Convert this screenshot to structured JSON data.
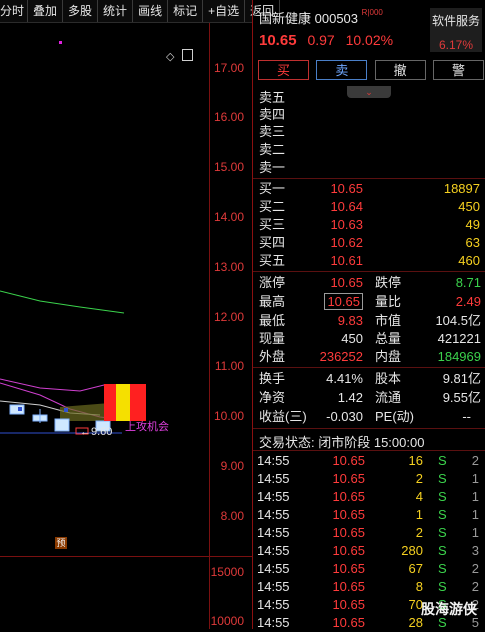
{
  "toolbar": {
    "items": [
      "分时",
      "叠加",
      "多股",
      "统计",
      "画线",
      "标记",
      "+自选",
      "返回"
    ]
  },
  "chart": {
    "y_labels": [
      "17.00",
      "16.00",
      "15.00",
      "14.00",
      "13.00",
      "12.00",
      "11.00",
      "10.00",
      "9.00",
      "8.00"
    ],
    "vol_labels": [
      "15000",
      "10000"
    ],
    "min_price_label": "←9.60",
    "signal_label": "上攻机会",
    "marker_label": "预"
  },
  "stock": {
    "name": "国新健康",
    "code": "000503",
    "badge": "R|000",
    "price": "10.65",
    "change": "0.97",
    "change_pct": "10.02%",
    "service_label": "软件服务",
    "service_pct": "6.17%"
  },
  "actions": {
    "buy": "买",
    "sell": "卖",
    "cancel": "撤",
    "alert": "警"
  },
  "order_book": {
    "asks": [
      {
        "label": "卖五",
        "price": "",
        "vol": ""
      },
      {
        "label": "卖四",
        "price": "",
        "vol": ""
      },
      {
        "label": "卖三",
        "price": "",
        "vol": ""
      },
      {
        "label": "卖二",
        "price": "",
        "vol": ""
      },
      {
        "label": "卖一",
        "price": "",
        "vol": ""
      }
    ],
    "bids": [
      {
        "label": "买一",
        "price": "10.65",
        "vol": "18897"
      },
      {
        "label": "买二",
        "price": "10.64",
        "vol": "450"
      },
      {
        "label": "买三",
        "price": "10.63",
        "vol": "49"
      },
      {
        "label": "买四",
        "price": "10.62",
        "vol": "63"
      },
      {
        "label": "买五",
        "price": "10.61",
        "vol": "460"
      }
    ]
  },
  "stats": {
    "limit_up_label": "涨停",
    "limit_up": "10.65",
    "limit_down_label": "跌停",
    "limit_down": "8.71",
    "high_label": "最高",
    "high": "10.65",
    "volume_ratio_label": "量比",
    "volume_ratio": "2.49",
    "low_label": "最低",
    "low": "9.83",
    "market_cap_label": "市值",
    "market_cap": "104.5亿",
    "current_vol_label": "现量",
    "current_vol": "450",
    "total_vol_label": "总量",
    "total_vol": "421221",
    "outer_label": "外盘",
    "outer": "236252",
    "inner_label": "内盘",
    "inner": "184969",
    "turnover_label": "换手",
    "turnover": "4.41%",
    "shares_label": "股本",
    "shares": "9.81亿",
    "net_assets_label": "净资",
    "net_assets": "1.42",
    "float_label": "流通",
    "float": "9.55亿",
    "eps_label": "收益(三)",
    "eps": "-0.030",
    "pe_label": "PE(动)",
    "pe": "--"
  },
  "trade_status": "交易状态: 闭市阶段 15:00:00",
  "ticks": [
    {
      "time": "14:55",
      "price": "10.65",
      "vol": "16",
      "side": "S",
      "n": "2"
    },
    {
      "time": "14:55",
      "price": "10.65",
      "vol": "2",
      "side": "S",
      "n": "1"
    },
    {
      "time": "14:55",
      "price": "10.65",
      "vol": "4",
      "side": "S",
      "n": "1"
    },
    {
      "time": "14:55",
      "price": "10.65",
      "vol": "1",
      "side": "S",
      "n": "1"
    },
    {
      "time": "14:55",
      "price": "10.65",
      "vol": "2",
      "side": "S",
      "n": "1"
    },
    {
      "time": "14:55",
      "price": "10.65",
      "vol": "280",
      "side": "S",
      "n": "3"
    },
    {
      "time": "14:55",
      "price": "10.65",
      "vol": "67",
      "side": "S",
      "n": "2"
    },
    {
      "time": "14:55",
      "price": "10.65",
      "vol": "8",
      "side": "S",
      "n": "2"
    },
    {
      "time": "14:55",
      "price": "10.65",
      "vol": "70",
      "side": "S",
      "n": "2"
    },
    {
      "time": "14:55",
      "price": "10.65",
      "vol": "28",
      "side": "S",
      "n": "5"
    }
  ],
  "watermark": "股海游侠"
}
